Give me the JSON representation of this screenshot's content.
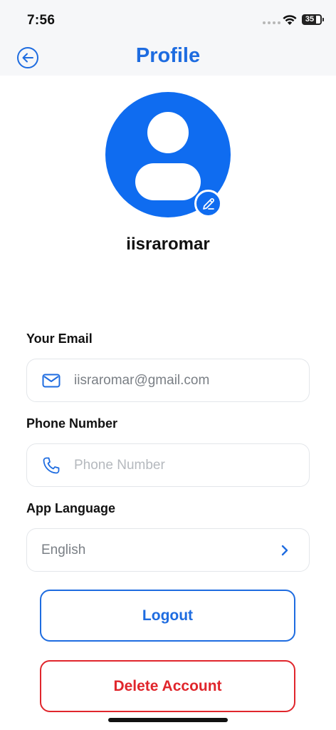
{
  "status_bar": {
    "time": "7:56",
    "battery_level": "35"
  },
  "header": {
    "title": "Profile",
    "back_icon": "arrow-left-circle-icon"
  },
  "profile": {
    "username": "iisraromar",
    "avatar_icon": "user-icon",
    "edit_icon": "pencil-icon"
  },
  "form": {
    "email": {
      "label": "Your Email",
      "value": "iisraromar@gmail.com",
      "icon": "mail-icon"
    },
    "phone": {
      "label": "Phone Number",
      "placeholder": "Phone Number",
      "icon": "phone-icon"
    },
    "language": {
      "label": "App Language",
      "value": "English",
      "icon": "chevron-right-icon"
    }
  },
  "actions": {
    "logout_label": "Logout",
    "delete_label": "Delete Account"
  },
  "colors": {
    "primary": "#1e6ce0",
    "avatar": "#0f6cf0",
    "danger": "#e0262c"
  }
}
